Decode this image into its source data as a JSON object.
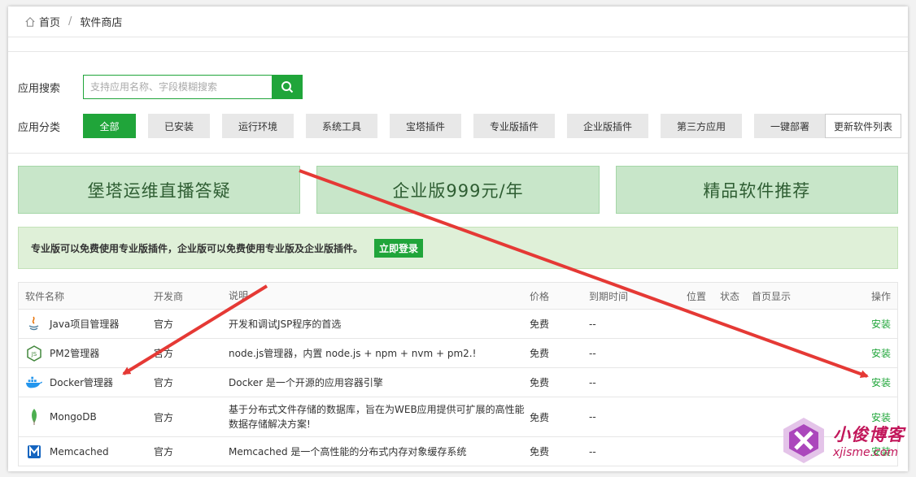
{
  "breadcrumb": {
    "home": "首页",
    "separator": "/",
    "current": "软件商店"
  },
  "search": {
    "label": "应用搜索",
    "placeholder": "支持应用名称、字段模糊搜索"
  },
  "categories": {
    "label": "应用分类",
    "items": [
      "全部",
      "已安装",
      "运行环境",
      "系统工具",
      "宝塔插件",
      "专业版插件",
      "企业版插件",
      "第三方应用",
      "一键部署"
    ],
    "active_index": 0,
    "refresh_label": "更新软件列表"
  },
  "banners": [
    "堡塔运维直播答疑",
    "企业版999元/年",
    "精品软件推荐"
  ],
  "notice": {
    "text": "专业版可以免费使用专业版插件，企业版可以免费使用专业版及企业版插件。",
    "button": "立即登录"
  },
  "table": {
    "headers": {
      "name": "软件名称",
      "developer": "开发商",
      "description": "说明",
      "price": "价格",
      "expiry": "到期时间",
      "position": "位置",
      "status": "状态",
      "homepage": "首页显示",
      "action": "操作"
    },
    "rows": [
      {
        "icon": "java-icon",
        "name": "Java项目管理器",
        "developer": "官方",
        "description": "开发和调试JSP程序的首选",
        "price": "免费",
        "expiry": "--",
        "action": "安装"
      },
      {
        "icon": "pm2-icon",
        "name": "PM2管理器",
        "developer": "官方",
        "description": "node.js管理器，内置 node.js + npm + nvm + pm2.!",
        "price": "免费",
        "expiry": "--",
        "action": "安装"
      },
      {
        "icon": "docker-icon",
        "name": "Docker管理器",
        "developer": "官方",
        "description": "Docker 是一个开源的应用容器引擎",
        "price": "免费",
        "expiry": "--",
        "action": "安装"
      },
      {
        "icon": "mongodb-icon",
        "name": "MongoDB",
        "developer": "官方",
        "description": "基于分布式文件存储的数据库，旨在为WEB应用提供可扩展的高性能数据存储解决方案!",
        "price": "免费",
        "expiry": "--",
        "action": "安装"
      },
      {
        "icon": "memcached-icon",
        "name": "Memcached",
        "developer": "官方",
        "description": "Memcached 是一个高性能的分布式内存对象缓存系统",
        "price": "免费",
        "expiry": "--",
        "action": "安装"
      }
    ]
  },
  "watermark": {
    "cn": "小俊博客",
    "en": "xjisme.com"
  },
  "colors": {
    "accent": "#20a53a",
    "arrow": "#e53935",
    "banner_bg": "#c8e6c9",
    "notice_bg": "#dff0d8"
  }
}
